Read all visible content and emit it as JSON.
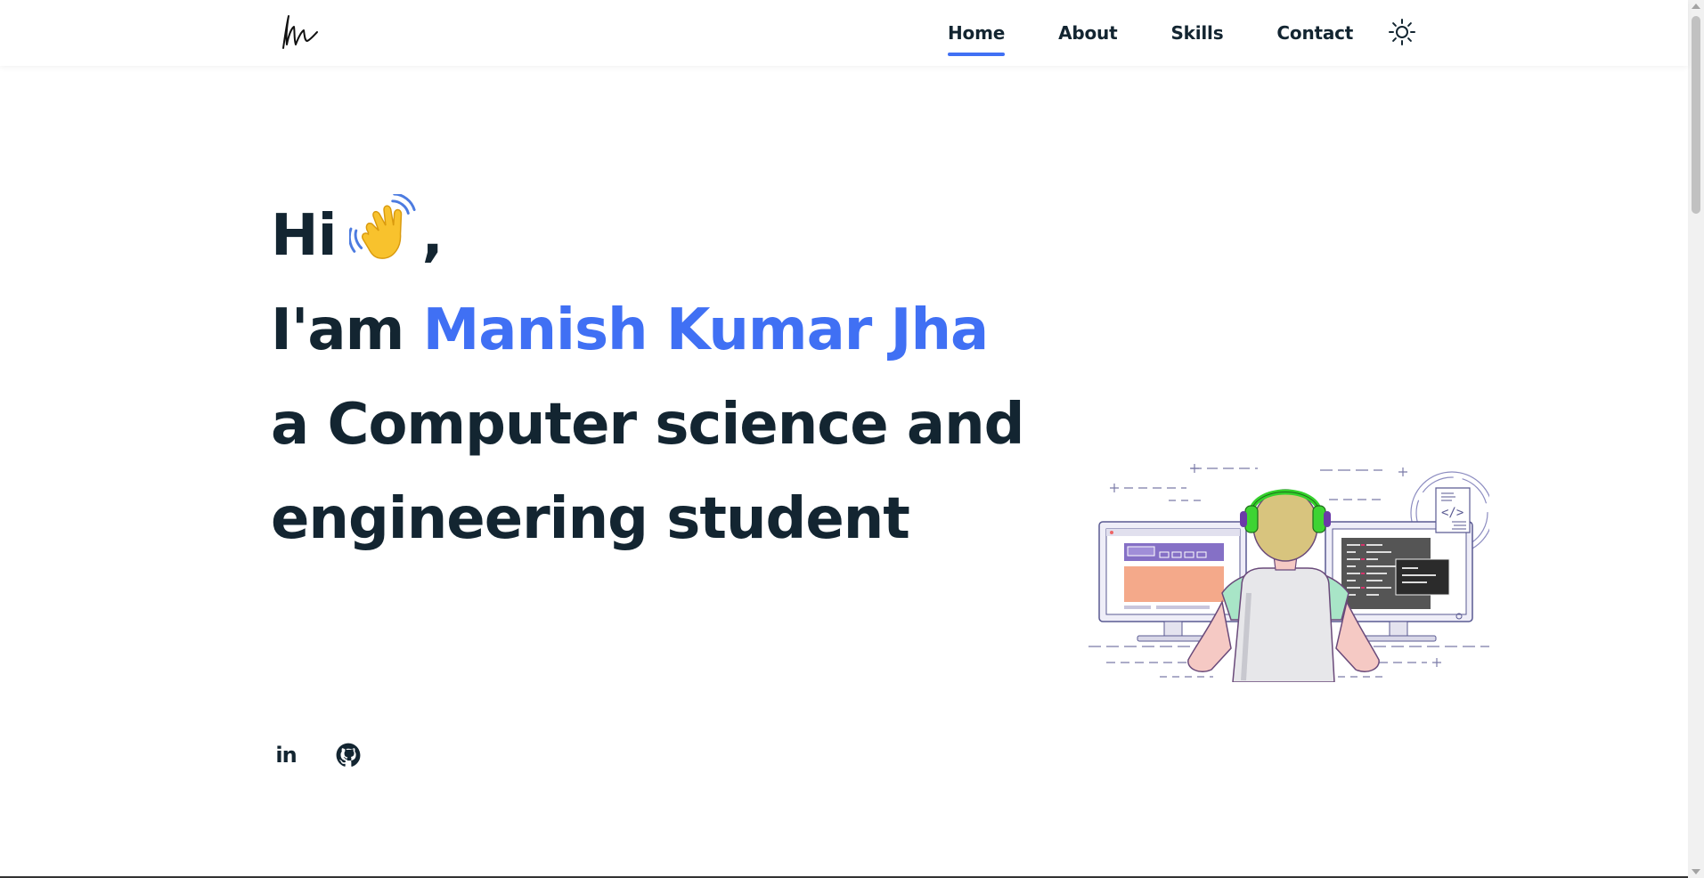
{
  "header": {
    "nav": [
      {
        "label": "Home",
        "active": true
      },
      {
        "label": "About",
        "active": false
      },
      {
        "label": "Skills",
        "active": false
      },
      {
        "label": "Contact",
        "active": false
      }
    ],
    "logo_icon": "signature-logo",
    "theme_toggle_icon": "sun-icon"
  },
  "hero": {
    "greeting": "Hi",
    "greeting_suffix": ",",
    "wave_icon": "waving-hand-emoji",
    "intro_prefix": "I'am",
    "name": "Manish Kumar Jha",
    "tagline_line1": "a Computer science and",
    "tagline_line2": "engineering student",
    "illustration": "developer-at-desk-illustration"
  },
  "socials": [
    {
      "name": "linkedin",
      "label": "in"
    },
    {
      "name": "github",
      "icon": "github-icon"
    }
  ],
  "colors": {
    "accent": "#4070f4",
    "text": "#132531",
    "background": "#ffffff"
  }
}
